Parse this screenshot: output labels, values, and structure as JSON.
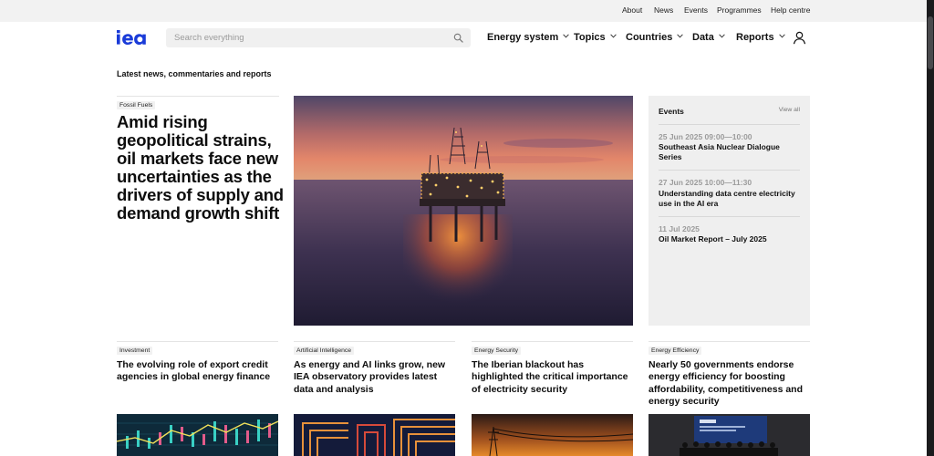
{
  "utility_nav": [
    {
      "label": "About"
    },
    {
      "label": "News"
    },
    {
      "label": "Events"
    },
    {
      "label": "Programmes"
    },
    {
      "label": "Help centre"
    }
  ],
  "header": {
    "logo_text": "iea",
    "search": {
      "placeholder": "Search everything",
      "value": ""
    },
    "nav": [
      {
        "label": "Energy system"
      },
      {
        "label": "Topics"
      },
      {
        "label": "Countries"
      },
      {
        "label": "Data"
      },
      {
        "label": "Reports"
      }
    ]
  },
  "section_title": "Latest news, commentaries and reports",
  "lead": {
    "tag": "Fossil Fuels",
    "title": "Amid rising geopolitical strains, oil markets face new uncertainties as the drivers of supply and demand growth shift"
  },
  "events": {
    "heading": "Events",
    "view_all": "View all",
    "items": [
      {
        "date": "25 Jun 2025 09:00—10:00",
        "title": "Southeast Asia Nuclear Dialogue Series"
      },
      {
        "date": "27 Jun 2025 10:00—11:30",
        "title": "Understanding data centre electricity use in the AI era"
      },
      {
        "date": "11 Jul 2025",
        "title": "Oil Market Report – July 2025"
      }
    ]
  },
  "cards": [
    {
      "tag": "Investment",
      "title": "The evolving role of export credit agencies in global energy finance"
    },
    {
      "tag": "Artificial Intelligence",
      "title": "As energy and AI links grow, new IEA observatory provides latest data and analysis"
    },
    {
      "tag": "Energy Security",
      "title": "The Iberian blackout has highlighted the critical importance of electricity security"
    },
    {
      "tag": "Energy Efficiency",
      "title": "Nearly 50 governments endorse energy efficiency for boosting affordability, competitiveness and energy security"
    }
  ],
  "colors": {
    "brand": "#1a3bd8",
    "accent_text": "#0d0d0d",
    "muted": "#9b9b9b"
  }
}
